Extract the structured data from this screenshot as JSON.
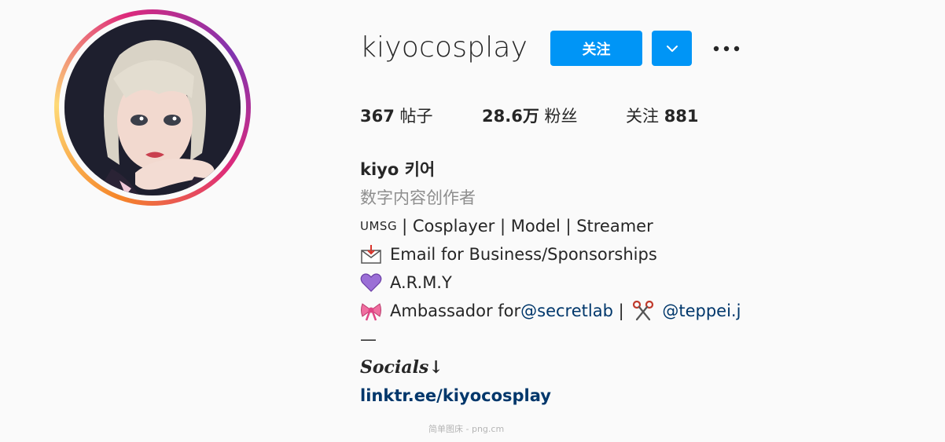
{
  "profile": {
    "username": "kiyocosplay",
    "follow_label": "关注",
    "dropdown_icon": "chevron-down-icon",
    "more_icon": "more-horizontal-icon",
    "avatar_icon": "profile-photo",
    "stats": {
      "posts_count": "367",
      "posts_label": "帖子",
      "followers_count": "28.6万",
      "followers_label": "粉丝",
      "following_label": "关注",
      "following_count": "881"
    },
    "bio": {
      "full_name": "kiyo 키어",
      "category": "数字内容创作者",
      "line1_prefix": "UMSG",
      "line1_text": " | Cosplayer | Model | Streamer",
      "line2_text": "Email for Business/Sponsorships",
      "line3_text": "A.R.M.Y",
      "line4_text": "Ambassador for ",
      "mention1": "@secretlab",
      "separator": " | ",
      "mention2": "@teppei.j",
      "dash": "—",
      "socials": "Socials↓",
      "link": "linktr.ee/kiyocosplay"
    }
  },
  "watermark": "简单图床 - png.cm",
  "colors": {
    "accent": "#0095f6",
    "link": "#00376b",
    "muted": "#8e8e8e",
    "text": "#262626",
    "background": "#fafafa"
  }
}
